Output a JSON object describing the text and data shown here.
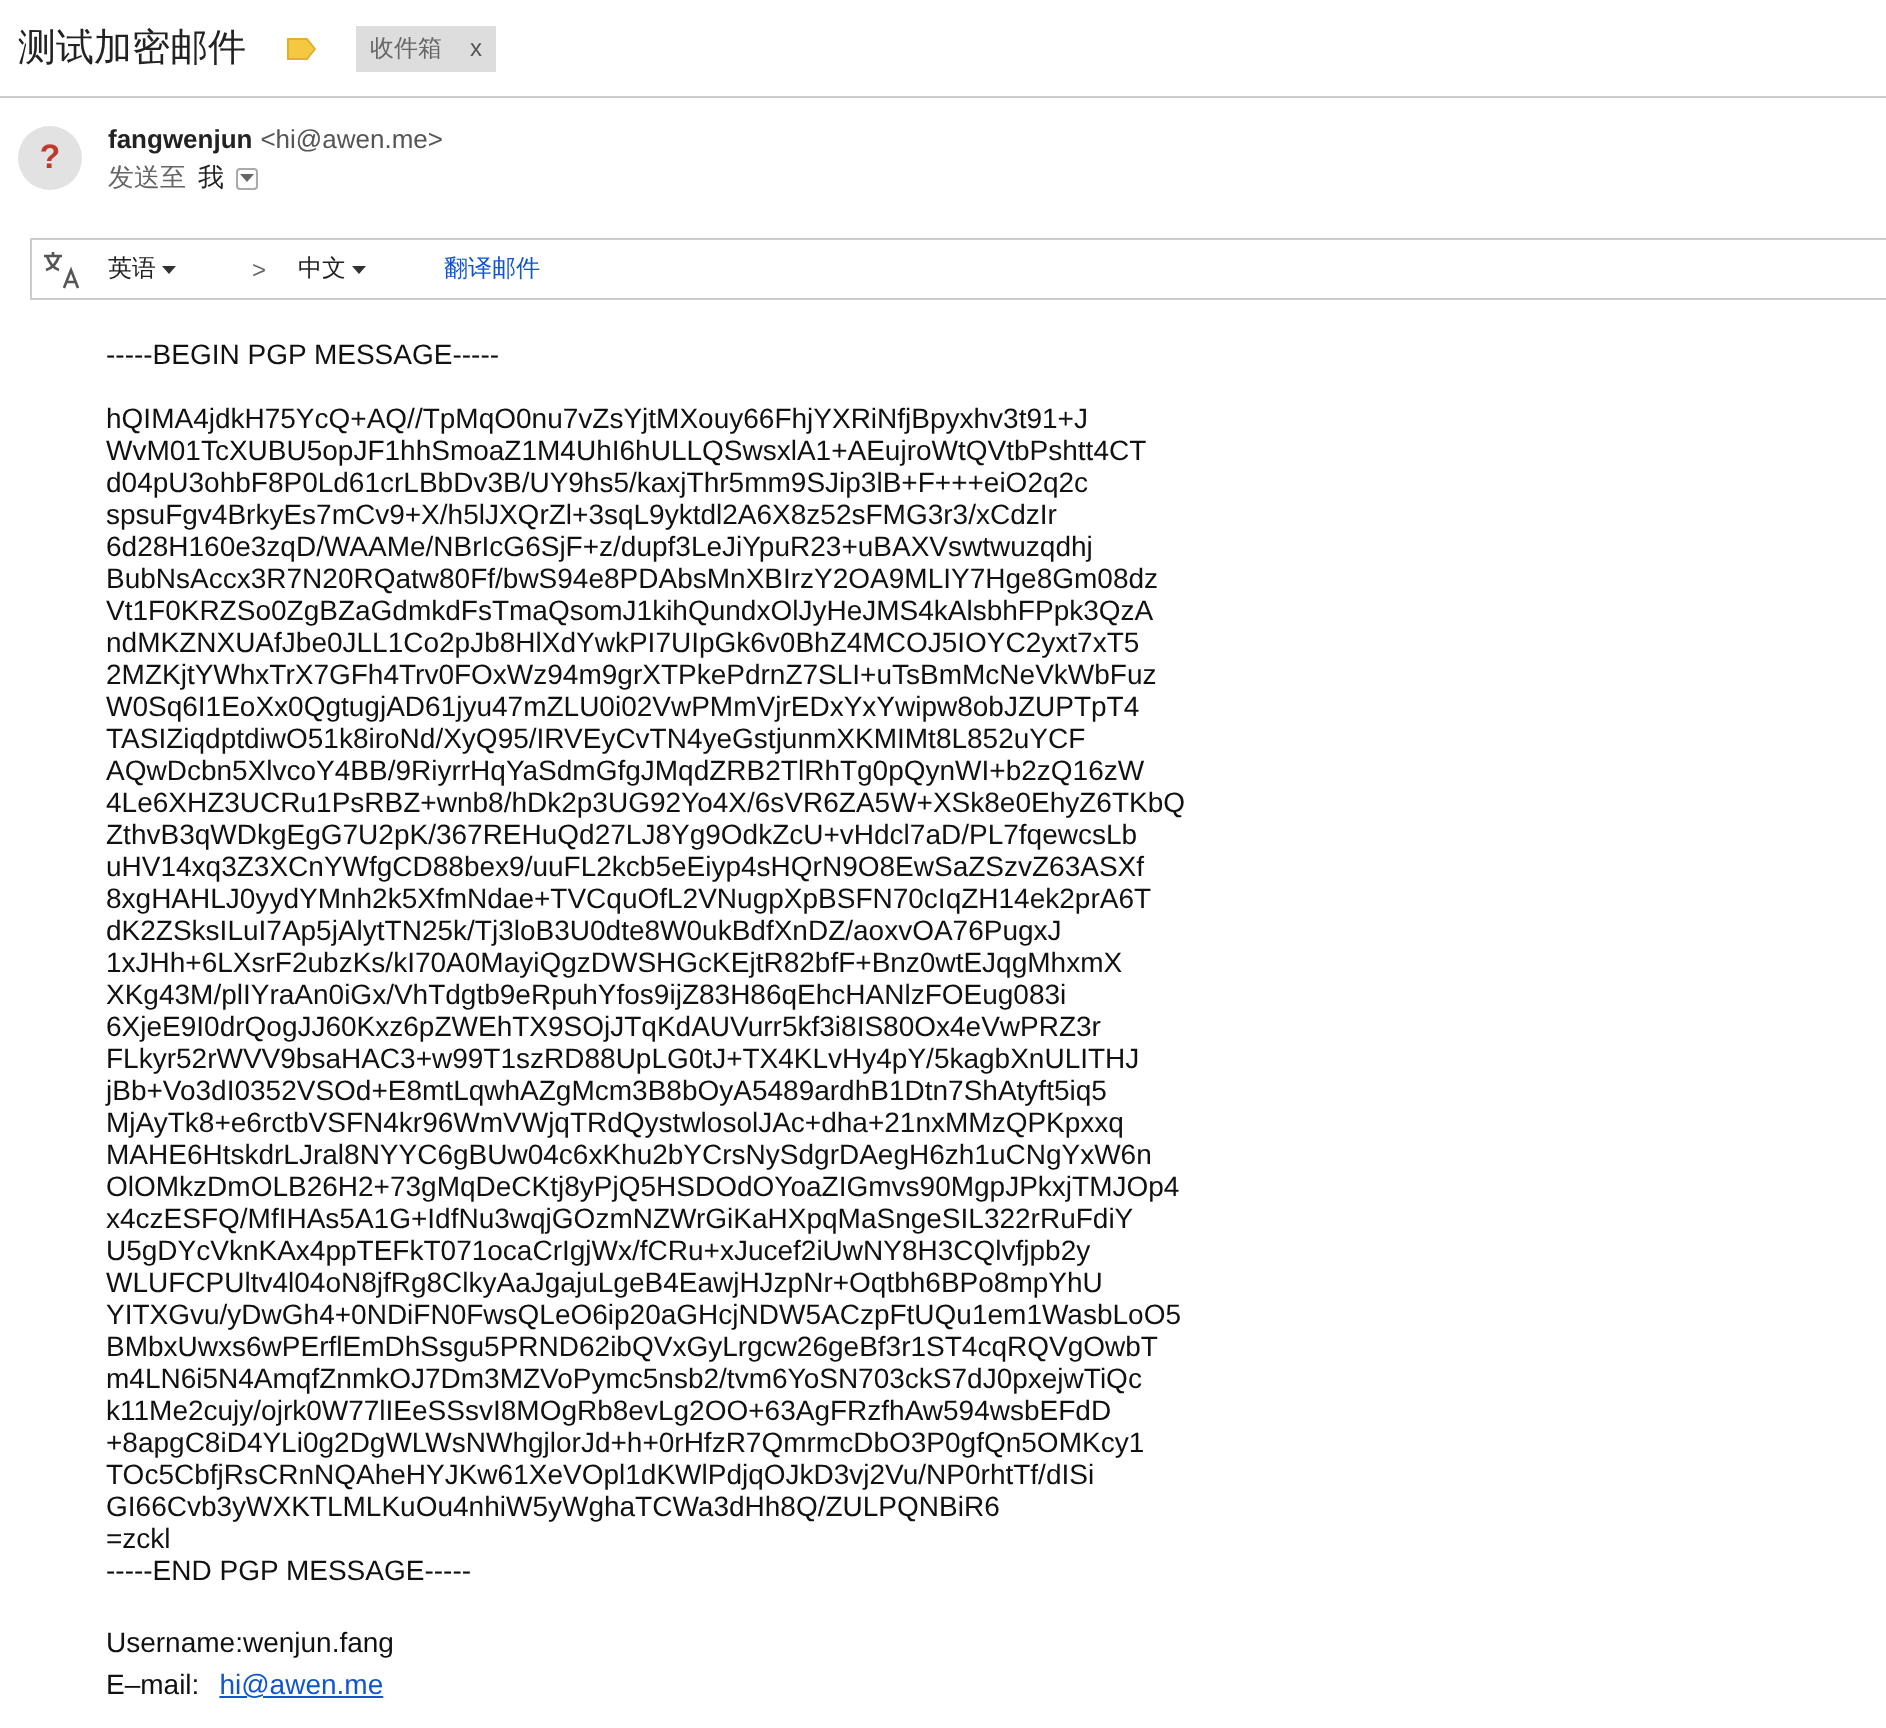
{
  "subject": "测试加密邮件",
  "labels": [
    {
      "text": "收件箱",
      "remove": "x"
    }
  ],
  "sender": {
    "name": "fangwenjun",
    "email": "<hi@awen.me>",
    "avatar": "?",
    "to_label": "发送至",
    "to": "我"
  },
  "translate": {
    "from": "英语",
    "arrow": ">",
    "to": "中文",
    "action": "翻译邮件"
  },
  "body": {
    "begin": "-----BEGIN PGP MESSAGE-----",
    "lines": [
      "hQIMA4jdkH75YcQ+AQ//TpMqO0nu7vZsYjtMXouy66FhjYXRiNfjBpyxhv3t91+J",
      "WvM01TcXUBU5opJF1hhSmoaZ1M4UhI6hULLQSwsxlA1+AEujroWtQVtbPshtt4CT",
      "d04pU3ohbF8P0Ld61crLBbDv3B/UY9hs5/kaxjThr5mm9SJip3lB+F+++eiO2q2c",
      "spsuFgv4BrkyEs7mCv9+X/h5lJXQrZl+3sqL9yktdl2A6X8z52sFMG3r3/xCdzIr",
      "6d28H160e3zqD/WAAMe/NBrIcG6SjF+z/dupf3LeJiYpuR23+uBAXVswtwuzqdhj",
      "BubNsAccx3R7N20RQatw80Ff/bwS94e8PDAbsMnXBIrzY2OA9MLIY7Hge8Gm08dz",
      "Vt1F0KRZSo0ZgBZaGdmkdFsTmaQsomJ1kihQundxOlJyHeJMS4kAlsbhFPpk3QzA",
      "ndMKZNXUAfJbe0JLL1Co2pJb8HlXdYwkPI7UIpGk6v0BhZ4MCOJ5IOYC2yxt7xT5",
      "2MZKjtYWhxTrX7GFh4Trv0FOxWz94m9grXTPkePdrnZ7SLI+uTsBmMcNeVkWbFuz",
      "W0Sq6I1EoXx0QgtugjAD61jyu47mZLU0i02VwPMmVjrEDxYxYwipw8obJZUPTpT4",
      "TASIZiqdptdiwO51k8iroNd/XyQ95/IRVEyCvTN4yeGstjunmXKMIMt8L852uYCF",
      "AQwDcbn5XlvcoY4BB/9RiyrrHqYaSdmGfgJMqdZRB2TlRhTg0pQynWI+b2zQ16zW",
      "4Le6XHZ3UCRu1PsRBZ+wnb8/hDk2p3UG92Yo4X/6sVR6ZA5W+XSk8e0EhyZ6TKbQ",
      "ZthvB3qWDkgEgG7U2pK/367REHuQd27LJ8Yg9OdkZcU+vHdcl7aD/PL7fqewcsLb",
      "uHV14xq3Z3XCnYWfgCD88bex9/uuFL2kcb5eEiyp4sHQrN9O8EwSaZSzvZ63ASXf",
      "8xgHAHLJ0yydYMnh2k5XfmNdae+TVCquOfL2VNugpXpBSFN70cIqZH14ek2prA6T",
      "dK2ZSksILuI7Ap5jAlytTN25k/Tj3loB3U0dte8W0ukBdfXnDZ/aoxvOA76PugxJ",
      "1xJHh+6LXsrF2ubzKs/kI70A0MayiQgzDWSHGcKEjtR82bfF+Bnz0wtEJqgMhxmX",
      "XKg43M/plIYraAn0iGx/VhTdgtb9eRpuhYfos9ijZ83H86qEhcHANlzFOEug083i",
      "6XjeE9I0drQogJJ60Kxz6pZWEhTX9SOjJTqKdAUVurr5kf3i8IS80Ox4eVwPRZ3r",
      "FLkyr52rWVV9bsaHAC3+w99T1szRD88UpLG0tJ+TX4KLvHy4pY/5kagbXnULITHJ",
      "jBb+Vo3dI0352VSOd+E8mtLqwhAZgMcm3B8bOyA5489ardhB1Dtn7ShAtyft5iq5",
      "MjAyTk8+e6rctbVSFN4kr96WmVWjqTRdQystwlosolJAc+dha+21nxMMzQPKpxxq",
      "MAHE6HtskdrLJral8NYYC6gBUw04c6xKhu2bYCrsNySdgrDAegH6zh1uCNgYxW6n",
      "OlOMkzDmOLB26H2+73gMqDeCKtj8yPjQ5HSDOdOYoaZIGmvs90MgpJPkxjTMJOp4",
      "x4czESFQ/MfIHAs5A1G+IdfNu3wqjGOzmNZWrGiKaHXpqMaSngeSIL322rRuFdiY",
      "U5gDYcVknKAx4ppTEFkT071ocaCrIgjWx/fCRu+xJucef2iUwNY8H3CQlvfjpb2y",
      "WLUFCPUltv4l04oN8jfRg8ClkyAaJgajuLgeB4EawjHJzpNr+Oqtbh6BPo8mpYhU",
      "YITXGvu/yDwGh4+0NDiFN0FwsQLeO6ip20aGHcjNDW5ACzpFtUQu1em1WasbLoO5",
      "BMbxUwxs6wPErflEmDhSsgu5PRND62ibQVxGyLrgcw26geBf3r1ST4cqRQVgOwbT",
      "m4LN6i5N4AmqfZnmkOJ7Dm3MZVoPymc5nsb2/tvm6YoSN703ckS7dJ0pxejwTiQc",
      "k11Me2cujy/ojrk0W77lIEeSSsvI8MOgRb8evLg2OO+63AgFRzfhAw594wsbEFdD",
      "+8apgC8iD4YLi0g2DgWLWsNWhgjlorJd+h+0rHfzR7QmrmcDbO3P0gfQn5OMKcy1",
      "TOc5CbfjRsCRnNQAheHYJKw61XeVOpl1dKWlPdjqOJkD3vj2Vu/NP0rhtTf/dISi",
      "GI66Cvb3yWXKTLMLKuOu4nhiW5yWghaTCWa3dHh8Q/ZULPQNBiR6",
      "=zckl"
    ],
    "end": "-----END PGP MESSAGE-----",
    "username": "Username:wenjun.fang",
    "email_label": "E–mail:",
    "email_link": "hi@awen.me"
  }
}
